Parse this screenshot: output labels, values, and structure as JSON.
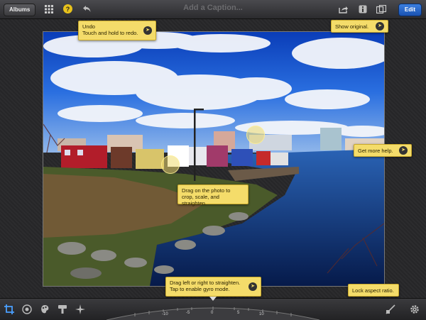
{
  "topbar": {
    "albums_label": "Albums",
    "grid_icon": "grid-icon",
    "help_icon": "question-icon",
    "help_glyph": "?",
    "undo_icon": "undo-icon",
    "caption_placeholder": "Add a Caption...",
    "share_icon": "share-icon",
    "info_icon": "info-icon",
    "compare_icon": "compare-icon",
    "edit_label": "Edit"
  },
  "tips": {
    "undo_title": "Undo",
    "undo_body": "Touch and hold to redo.",
    "show_original": "Show original.",
    "more_help": "Get more help.",
    "drag_photo_line1": "Drag on the photo to",
    "drag_photo_line2": "crop, scale, and straighten.",
    "straighten_line1": "Drag left or right to straighten.",
    "straighten_line2": "Tap to enable gyro mode.",
    "lock_aspect": "Lock aspect ratio."
  },
  "toolbar": {
    "tools": [
      "crop-icon",
      "exposure-icon",
      "color-icon",
      "brushes-icon",
      "effects-icon"
    ],
    "aspect_lock_icon": "aspect-lock-icon",
    "settings_icon": "gear-icon"
  },
  "dial": {
    "labels": [
      "-10",
      "-5",
      "0",
      "5",
      "10"
    ]
  }
}
